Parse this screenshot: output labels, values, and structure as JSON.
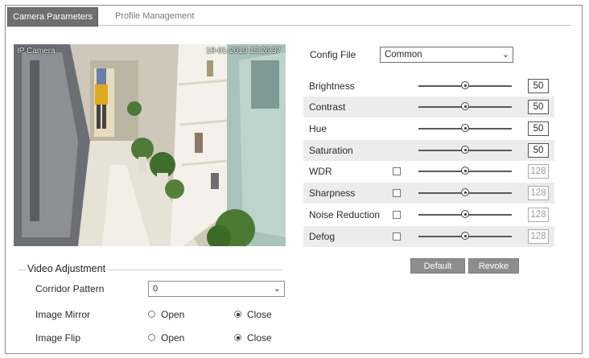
{
  "tabs": [
    {
      "label": "Camera Parameters",
      "active": true
    },
    {
      "label": "Profile Management",
      "active": false
    }
  ],
  "preview": {
    "osd_name": "IP Camera",
    "osd_time": "10-01-2019 15:26:37"
  },
  "config": {
    "label": "Config File",
    "value": "Common"
  },
  "params": [
    {
      "label": "Brightness",
      "value": "50",
      "has_checkbox": false,
      "enabled": true,
      "level": 0.5
    },
    {
      "label": "Contrast",
      "value": "50",
      "has_checkbox": false,
      "enabled": true,
      "level": 0.5
    },
    {
      "label": "Hue",
      "value": "50",
      "has_checkbox": false,
      "enabled": true,
      "level": 0.5
    },
    {
      "label": "Saturation",
      "value": "50",
      "has_checkbox": false,
      "enabled": true,
      "level": 0.5
    },
    {
      "label": "WDR",
      "value": "128",
      "has_checkbox": true,
      "enabled": false,
      "level": 0.5
    },
    {
      "label": "Sharpness",
      "value": "128",
      "has_checkbox": true,
      "enabled": false,
      "level": 0.5
    },
    {
      "label": "Noise Reduction",
      "value": "128",
      "has_checkbox": true,
      "enabled": false,
      "level": 0.5
    },
    {
      "label": "Defog",
      "value": "128",
      "has_checkbox": true,
      "enabled": false,
      "level": 0.5
    }
  ],
  "buttons": {
    "default_label": "Default",
    "revoke_label": "Revoke"
  },
  "video_adjustment": {
    "title": "Video Adjustment",
    "corridor_label": "Corridor Pattern",
    "corridor_value": "0",
    "mirror_label": "Image Mirror",
    "flip_label": "Image Flip",
    "open_label": "Open",
    "close_label": "Close",
    "mirror_selected": "Close",
    "flip_selected": "Close"
  },
  "colors": {
    "active_tab": "#6f6f6f",
    "button": "#8d8d8d",
    "row_shade": "#ececec"
  }
}
